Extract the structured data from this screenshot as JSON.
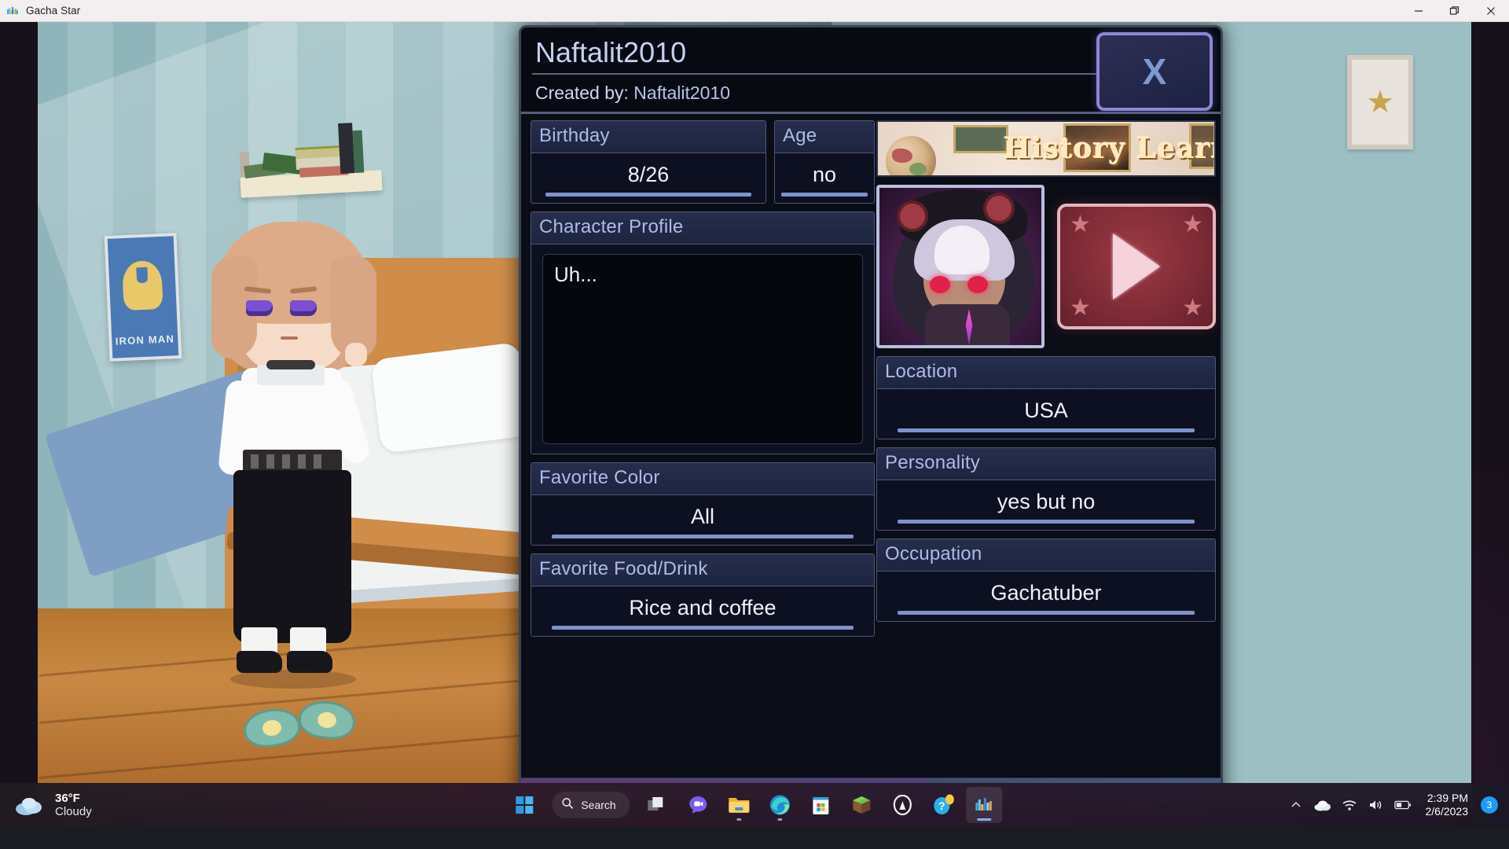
{
  "window": {
    "title": "Gacha Star",
    "app_icon": "gacha-star-icon",
    "controls": {
      "minimize": "minimize-icon",
      "restore": "restore-icon",
      "close": "close-icon"
    }
  },
  "game_scene": {
    "poster_text": "IRON MAN",
    "description": "bedroom-background-with-character"
  },
  "profile": {
    "title": "Naftalit2010",
    "created_by_label": "Created by:",
    "created_by_value": "Naftalit2010",
    "close_label": "X",
    "fields": {
      "birthday": {
        "label": "Birthday",
        "value": "8/26"
      },
      "age": {
        "label": "Age",
        "value": "no"
      },
      "character_profile": {
        "label": "Character Profile",
        "value": "Uh..."
      },
      "favorite_color": {
        "label": "Favorite Color",
        "value": "All"
      },
      "favorite_food_drink": {
        "label": "Favorite Food/Drink",
        "value": "Rice and coffee"
      },
      "location": {
        "label": "Location",
        "value": "USA"
      },
      "personality": {
        "label": "Personality",
        "value": "yes but no"
      },
      "occupation": {
        "label": "Occupation",
        "value": "Gachatuber"
      }
    },
    "banner_title": "History Learner",
    "avatar_alt": "character-avatar",
    "play_button": "play-icon",
    "colors": {
      "panel_bg": "#0b0d16",
      "field_border": "#4c5878",
      "label_text": "#aebbe8",
      "value_text": "#eef2f8",
      "underline": "#7f92c9",
      "close_border": "#8f86d6",
      "play_bg": "#7e2b36",
      "footer_gradient_start": "#8a5fa8",
      "footer_gradient_end": "#86a2d4"
    }
  },
  "taskbar": {
    "weather": {
      "temperature": "36°F",
      "condition": "Cloudy",
      "icon": "cloud-icon"
    },
    "search_placeholder": "Search",
    "items": [
      {
        "name": "start-button",
        "icon": "windows-logo-icon"
      },
      {
        "name": "search-button",
        "icon": "search-icon"
      },
      {
        "name": "task-view-button",
        "icon": "task-view-icon"
      },
      {
        "name": "chat-button",
        "icon": "chat-icon"
      },
      {
        "name": "file-explorer-button",
        "icon": "folder-icon"
      },
      {
        "name": "edge-button",
        "icon": "edge-icon"
      },
      {
        "name": "microsoft-store-button",
        "icon": "store-icon"
      },
      {
        "name": "minecraft-button",
        "icon": "minecraft-icon"
      },
      {
        "name": "arch-app-button",
        "icon": "arch-icon"
      },
      {
        "name": "quiz-app-button",
        "icon": "quiz-balloon-icon"
      },
      {
        "name": "gacha-star-button",
        "icon": "gacha-star-icon"
      }
    ],
    "tray": {
      "chevron": "chevron-up-icon",
      "onedrive": "onedrive-cloud-icon",
      "wifi": "wifi-icon",
      "volume": "volume-icon",
      "battery": "battery-icon",
      "time": "2:39 PM",
      "date": "2/6/2023",
      "notification_count": "3"
    }
  }
}
